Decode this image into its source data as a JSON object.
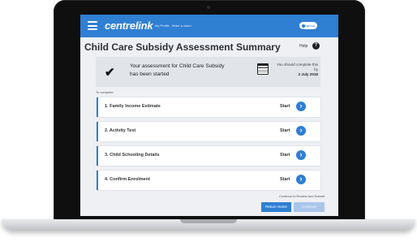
{
  "header": {
    "brand": "centrelink",
    "nav": [
      "My Profile",
      "Make a claim"
    ],
    "signout_label": "Signout"
  },
  "page": {
    "title": "Child Care Subsidy Assessment Summary",
    "help_label": "Help",
    "help_icon": "?"
  },
  "banner": {
    "icon": "check-icon",
    "message": "Your assessment for Child Care Subsidy has been started",
    "due_label": "You should complete this by",
    "due_date": "2 July 2018"
  },
  "tasks_heading": "To complete",
  "tasks": [
    {
      "label": "1.   Family Income Estimate",
      "action": "Start"
    },
    {
      "label": "2.   Activity Test",
      "action": "Start"
    },
    {
      "label": "3.   Child Schooling Details",
      "action": "Start"
    },
    {
      "label": "4.   Confirm Enrolment",
      "action": "Start"
    }
  ],
  "footer": {
    "hint": "Continue to Review and Submit",
    "return_label": "Return Home",
    "continue_label": "Continue"
  },
  "colors": {
    "accent": "#2f7fd3",
    "disabled": "#a9c6ea"
  }
}
